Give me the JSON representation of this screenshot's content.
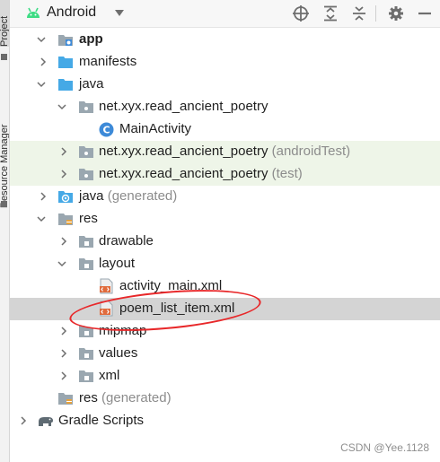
{
  "side_strip": {
    "project_tab": "Project",
    "resource_manager_tab": "Resource Manager"
  },
  "toolbar": {
    "view_selector": "Android",
    "icons": [
      "crosshair-icon",
      "expand-all-icon",
      "collapse-all-icon",
      "gear-icon",
      "hide-icon"
    ]
  },
  "tree": {
    "app": "app",
    "manifests": "manifests",
    "java": "java",
    "pkg_main": "net.xyx.read_ancient_poetry",
    "main_activity": "MainActivity",
    "pkg_android_test": "net.xyx.read_ancient_poetry",
    "pkg_android_test_suffix": "(androidTest)",
    "pkg_test": "net.xyx.read_ancient_poetry",
    "pkg_test_suffix": "(test)",
    "java_generated": "java",
    "java_generated_suffix": "(generated)",
    "res": "res",
    "drawable": "drawable",
    "layout": "layout",
    "activity_main": "activity_main.xml",
    "poem_list_item": "poem_list_item.xml",
    "mipmap": "mipmap",
    "values": "values",
    "xml": "xml",
    "res_generated": "res",
    "res_generated_suffix": "(generated)",
    "gradle_scripts": "Gradle Scripts"
  },
  "selected_item": "poem_list_item.xml",
  "colors": {
    "test_row_bg": "#eef5e8",
    "selected_row_bg": "#d4d4d4",
    "annotation": "#e8282a",
    "android_green": "#3ddc84"
  },
  "watermark": "CSDN @Yee.1128"
}
